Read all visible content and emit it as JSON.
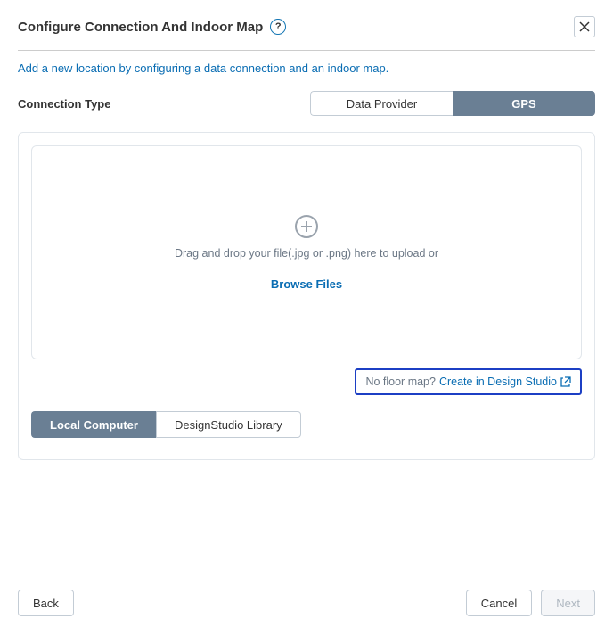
{
  "header": {
    "title": "Configure Connection And Indoor Map",
    "help": "?"
  },
  "subtitle": "Add a new location by configuring a data connection and an indoor map.",
  "connection": {
    "label": "Connection Type",
    "options": [
      "Data Provider",
      "GPS"
    ]
  },
  "upload": {
    "drop_text": "Drag and drop your file(.jpg or .png) here to upload or",
    "browse": "Browse Files"
  },
  "studio": {
    "question": "No floor map?",
    "link": "Create in Design Studio"
  },
  "source_tabs": [
    "Local Computer",
    "DesignStudio Library"
  ],
  "footer": {
    "back": "Back",
    "cancel": "Cancel",
    "next": "Next"
  }
}
